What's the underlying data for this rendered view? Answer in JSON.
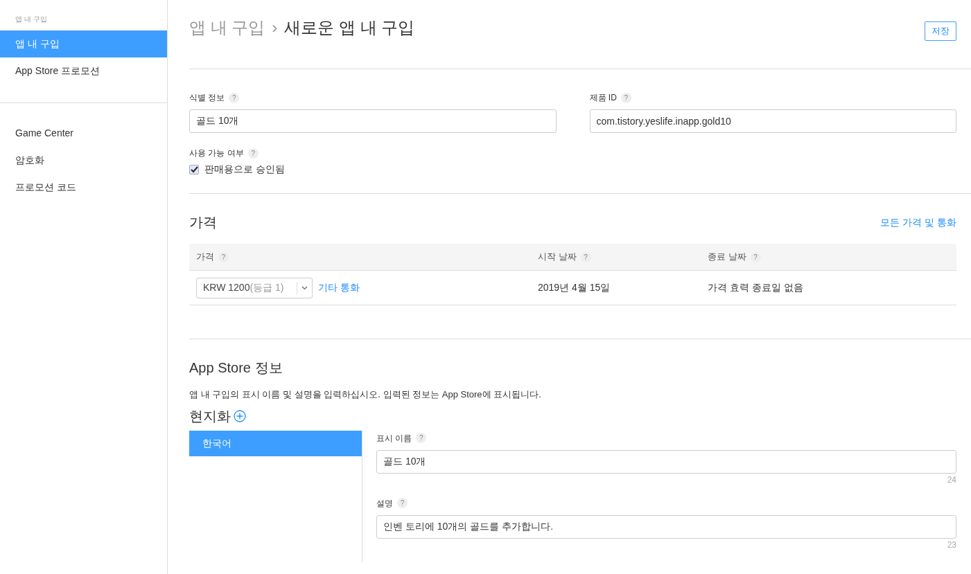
{
  "sidebar": {
    "section_title": "앱 내 구입",
    "groups": [
      [
        {
          "label": "앱 내 구입",
          "selected": true
        },
        {
          "label": "App Store 프로모션",
          "selected": false
        }
      ],
      [
        {
          "label": "Game Center",
          "selected": false
        },
        {
          "label": "암호화",
          "selected": false
        },
        {
          "label": "프로모션 코드",
          "selected": false
        }
      ]
    ]
  },
  "breadcrumb": {
    "parent": "앱 내 구입",
    "separator": "›",
    "current": "새로운 앱 내 구입"
  },
  "save_button": "저장",
  "fields": [
    {
      "label": "식별 정보",
      "help": "?",
      "value": "골드 10개"
    },
    {
      "label": "제품 ID",
      "help": "?",
      "value": "com.tistory.yeslife.inapp.gold10"
    }
  ],
  "availability": {
    "label": "사용 가능 여부",
    "help": "?",
    "checkbox": {
      "label": "판매용으로 승인됨",
      "checked": true
    }
  },
  "pricing": {
    "title": "가격",
    "link": "모든 가격 및 통화",
    "columns": [
      {
        "label": "가격",
        "help": "?"
      },
      {
        "label": "시작 날짜",
        "help": "?"
      },
      {
        "label": "종료 날짜",
        "help": "?"
      }
    ],
    "rows": [
      {
        "price": "KRW 1200",
        "tier": "(등급 1)",
        "other_link": "기타 통화",
        "start": "2019년 4월 15일",
        "end": "가격 효력 종료일 없음"
      }
    ]
  },
  "app_store": {
    "title": "App Store 정보",
    "description": "앱 내 구입의 표시 이름 및 설명을 입력하십시오. 입력된 정보는 App Store에 표시됩니다.",
    "localization_title": "현지화",
    "languages": [
      {
        "label": "한국어",
        "selected": true
      }
    ],
    "fields": [
      {
        "label": "표시 이름",
        "help": "?",
        "value": "골드 10개",
        "count": "24"
      },
      {
        "label": "설명",
        "help": "?",
        "value": "인벤 토리에 10개의 골드를 추가합니다.",
        "count": "23"
      }
    ]
  }
}
